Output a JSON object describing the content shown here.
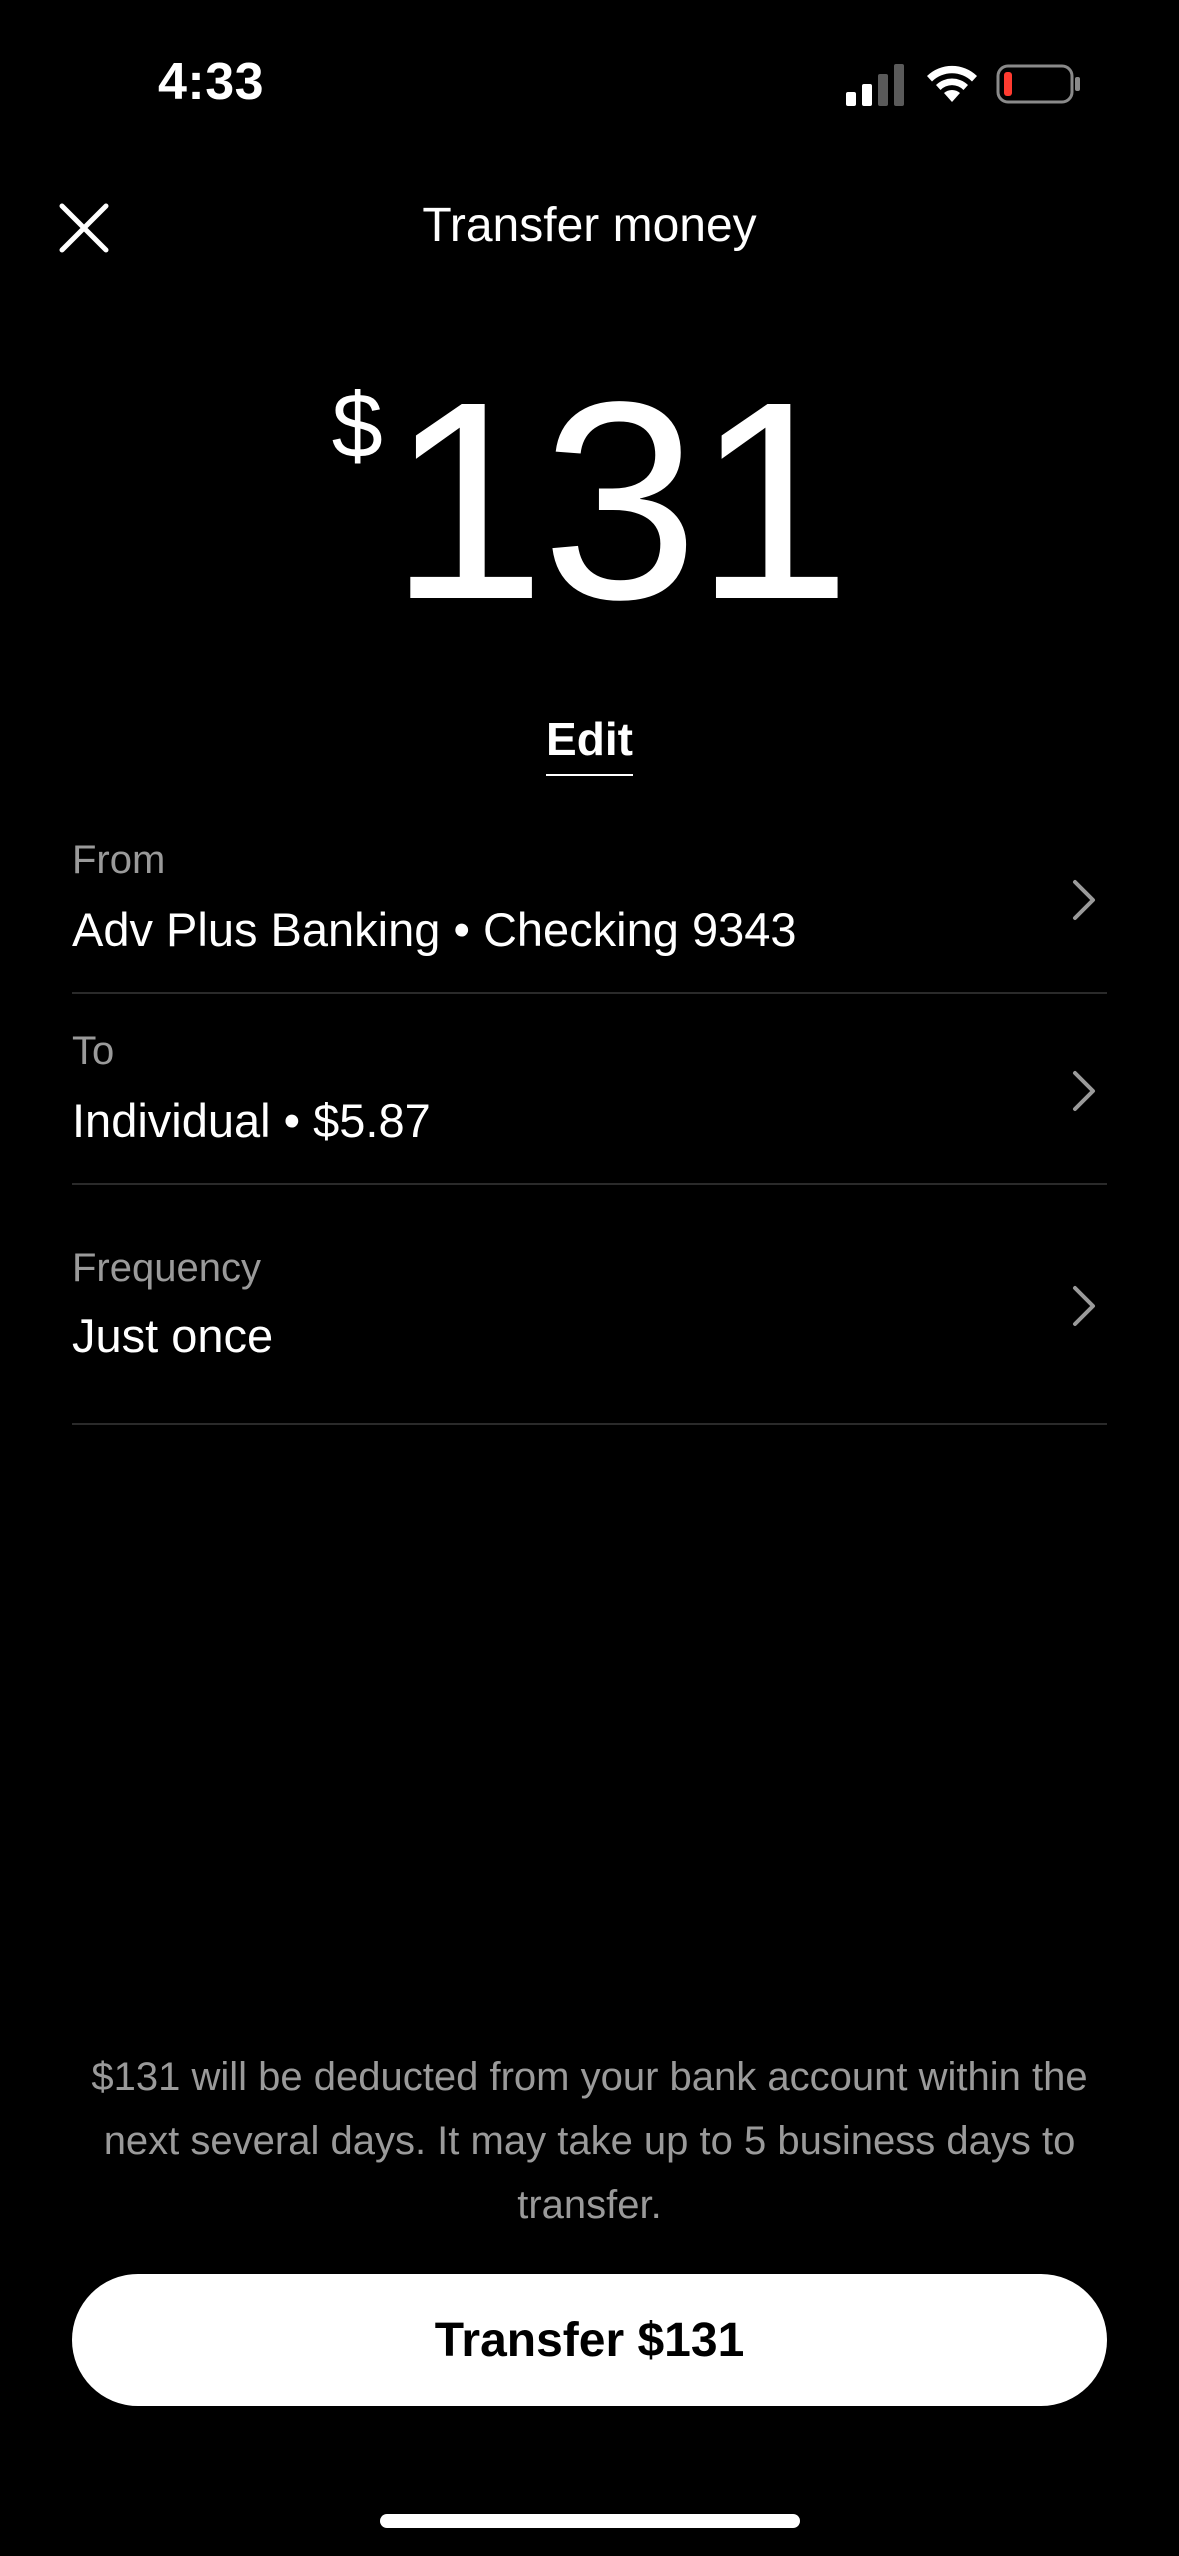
{
  "status_bar": {
    "time": "4:33",
    "signal_icon": "cellular-signal-icon",
    "wifi_icon": "wifi-icon",
    "battery_icon": "battery-low-icon",
    "battery_level": 0.1,
    "battery_color": "#ff3b30"
  },
  "header": {
    "title": "Transfer money",
    "close_icon": "close-icon"
  },
  "amount": {
    "currency_symbol": "$",
    "value": "131",
    "edit_label": "Edit"
  },
  "details": [
    {
      "label": "From",
      "value": "Adv Plus Banking • Checking 9343",
      "icon": "chevron-right-icon"
    },
    {
      "label": "To",
      "value": "Individual • $5.87",
      "icon": "chevron-right-icon"
    },
    {
      "label": "Frequency",
      "value": "Just once",
      "icon": "chevron-right-icon"
    }
  ],
  "disclaimer": "$131 will be deducted from your bank account within the next several days. It may take up to 5 business days to transfer.",
  "primary_action": {
    "label": "Transfer $131"
  },
  "colors": {
    "background": "#000000",
    "text_primary": "#ffffff",
    "text_secondary": "#9a9a9a",
    "divider": "#2a2a2a",
    "button_bg": "#ffffff",
    "button_text": "#000000"
  }
}
